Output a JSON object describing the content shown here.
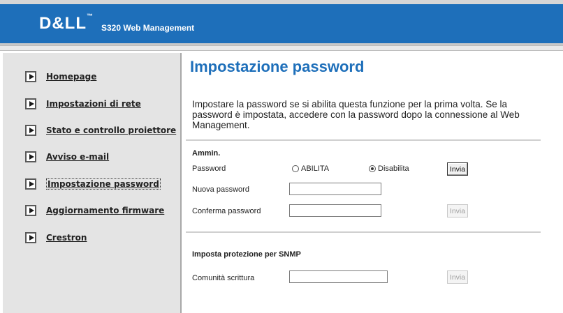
{
  "header": {
    "logo": "D&LL",
    "logo_tm": "™",
    "product": "S320 Web Management"
  },
  "sidebar": {
    "items": [
      {
        "label": "Homepage"
      },
      {
        "label": "Impostazioni di rete"
      },
      {
        "label": "Stato e controllo proiettore"
      },
      {
        "label": "Avviso e-mail"
      },
      {
        "label": "Impostazione password",
        "active": true
      },
      {
        "label": "Aggiornamento firmware"
      },
      {
        "label": "Crestron"
      }
    ]
  },
  "main": {
    "title": "Impostazione password",
    "description": "Impostare la password se si abilita questa funzione per la prima volta. Se la password è impostata, accedere con la password dopo la connessione al Web Management.",
    "admin": {
      "heading": "Ammin.",
      "password_label": "Password",
      "radio_enable": "ABILITA",
      "radio_disable": "Disabilita",
      "selected": "Disabilita",
      "submit_label": "Invia",
      "new_password_label": "Nuova password",
      "new_password_value": "",
      "confirm_password_label": "Conferma password",
      "confirm_password_value": "",
      "confirm_submit_label": "Invia"
    },
    "snmp": {
      "heading": "Imposta protezione per SNMP",
      "write_community_label": "Comunità scrittura",
      "write_community_value": "",
      "submit_label": "Invia"
    }
  },
  "colors": {
    "header_blue": "#1e6fba",
    "title_blue": "#1e6fba",
    "sidebar_bg": "#e4e4e4"
  }
}
